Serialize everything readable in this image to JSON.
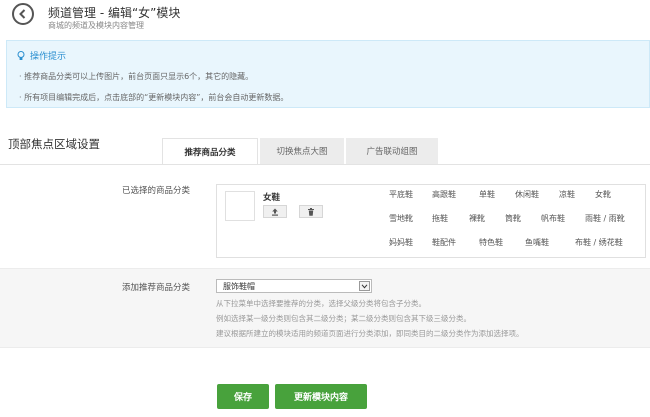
{
  "header": {
    "title": "频道管理 - 编辑“女”模块",
    "subtitle": "商城的频道及模块内容管理"
  },
  "tips": {
    "title": "操作提示",
    "lines": [
      "· 推荐商品分类可以上传图片，前台页面只显示6个，其它的隐藏。",
      "· 所有项目编辑完成后，点击底部的“更新模块内容”，前台会自动更新数据。"
    ]
  },
  "section_title": "顶部焦点区域设置",
  "tabs": [
    {
      "label": "推荐商品分类",
      "active": true
    },
    {
      "label": "切换焦点大图",
      "active": false
    },
    {
      "label": "广告联动组图",
      "active": false
    }
  ],
  "selected": {
    "label": "已选择的商品分类",
    "category_name": "女鞋",
    "subcategories": [
      [
        "平底鞋",
        "高跟鞋",
        "单鞋",
        "休闲鞋",
        "凉鞋",
        "女靴"
      ],
      [
        "雪地靴",
        "拖鞋",
        "裸靴",
        "筒靴",
        "帆布鞋",
        "雨鞋 / 雨靴"
      ],
      [
        "妈妈鞋",
        "鞋配件",
        "特色鞋",
        "鱼嘴鞋",
        "布鞋 / 绣花鞋"
      ]
    ]
  },
  "add": {
    "label": "添加推荐商品分类",
    "select_value": "服饰鞋帽",
    "help": [
      "从下拉菜单中选择要推荐的分类，选择父级分类将包含子分类。",
      "例如选择某一级分类则包含其二级分类；某二级分类则包含其下级三级分类。",
      "建议根据所建立的模块适用的频道页面进行分类添加，即同类目的二级分类作为添加选择项。"
    ]
  },
  "buttons": {
    "save": "保存",
    "update": "更新模块内容"
  },
  "colors": {
    "accent_green": "#48a23c",
    "tip_blue": "#2a8fd0",
    "tip_bg": "#e9f6fd"
  }
}
